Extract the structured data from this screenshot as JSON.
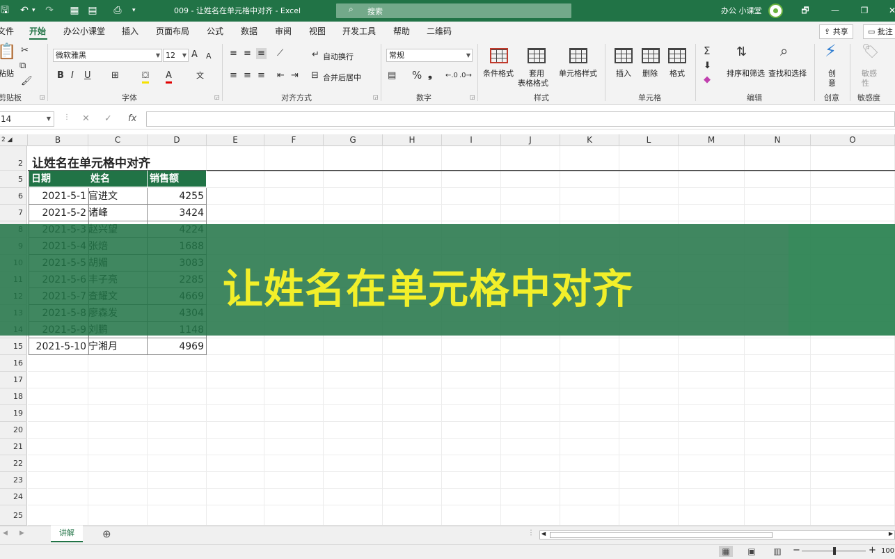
{
  "titlebar": {
    "title": "009 - 让姓名在单元格中对齐  -  Excel",
    "search_placeholder": "搜索",
    "account": "办公 小课堂",
    "qa_save": "🖫",
    "qa_undo": "↶",
    "qa_redo": "↷",
    "qa_more": "▾",
    "restore_icon": "🗗",
    "min_icon": "—",
    "max_icon": "❐",
    "close_icon": "✕"
  },
  "menu": {
    "items": [
      "文件",
      "开始",
      "办公小课堂",
      "插入",
      "页面布局",
      "公式",
      "数据",
      "审阅",
      "视图",
      "开发工具",
      "帮助",
      "二维码"
    ],
    "active_index": 1,
    "share": "共享",
    "comments": "批注"
  },
  "ribbon": {
    "clipboard": {
      "paste": "粘贴",
      "label": "剪贴板"
    },
    "font": {
      "name": "微软雅黑",
      "size": "12",
      "bold": "B",
      "italic": "I",
      "underline": "U",
      "grow": "A",
      "shrink": "A",
      "label": "字体"
    },
    "alignment": {
      "wrap": "自动换行",
      "merge": "合并后居中",
      "label": "对齐方式"
    },
    "number": {
      "format": "常规",
      "percent": "%",
      "comma": "❟",
      "label": "数字"
    },
    "styles": {
      "conditional": "条件格式",
      "table": "套用",
      "table2": "表格格式",
      "cell": "单元格样式",
      "label": "样式"
    },
    "cells": {
      "insert": "插入",
      "delete": "删除",
      "format": "格式",
      "label": "单元格"
    },
    "editing": {
      "sort": "排序和筛选",
      "find": "查找和选择",
      "label": "编辑"
    },
    "ideas": {
      "create": "创",
      "create2": "意",
      "label": "创意"
    },
    "sensitivity": {
      "btn": "敏感",
      "btn2": "性",
      "label": "敏感度"
    }
  },
  "formulabar": {
    "namebox": "14",
    "cancel": "✕",
    "enter": "✓",
    "fx": "fx",
    "value": ""
  },
  "sheet": {
    "columns": [
      "B",
      "C",
      "D",
      "E",
      "F",
      "G",
      "H",
      "I",
      "J",
      "K",
      "L",
      "M",
      "N",
      "O"
    ],
    "row_numbers": [
      "2",
      "5",
      "6",
      "7",
      "8",
      "9",
      "10",
      "11",
      "12",
      "13",
      "14",
      "15",
      "16",
      "17",
      "18",
      "19",
      "20",
      "21",
      "22",
      "23",
      "24",
      "25"
    ],
    "title": "让姓名在单元格中对齐",
    "table_headers": [
      "日期",
      "姓名",
      "销售额"
    ],
    "rows": [
      [
        "2021-5-1",
        "官进文",
        "4255"
      ],
      [
        "2021-5-2",
        "诸峰",
        "3424"
      ],
      [
        "2021-5-3",
        "赵兴望",
        "4224"
      ],
      [
        "2021-5-4",
        "张焙",
        "1688"
      ],
      [
        "2021-5-5",
        "胡媚",
        "3083"
      ],
      [
        "2021-5-6",
        "丰子亮",
        "2285"
      ],
      [
        "2021-5-7",
        "查耀文",
        "4669"
      ],
      [
        "2021-5-8",
        "廖森发",
        "4304"
      ],
      [
        "2021-5-9",
        "刘鹏",
        "1148"
      ],
      [
        "2021-5-10",
        "宁湘月",
        "4969"
      ]
    ]
  },
  "banner": {
    "text": "让姓名在单元格中对齐"
  },
  "tabs": {
    "sheet": "讲解",
    "add": "⊕"
  },
  "status": {
    "zoom": "100",
    "minus": "−",
    "plus": "+"
  }
}
